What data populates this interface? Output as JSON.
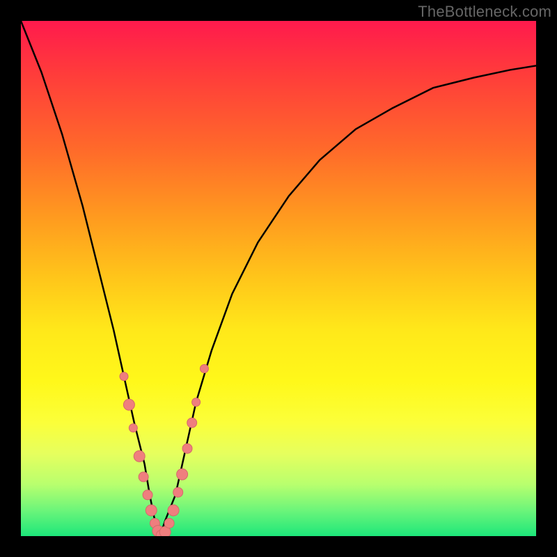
{
  "watermark": "TheBottleneck.com",
  "colors": {
    "curve": "#000000",
    "dot_fill": "#ef7e7e",
    "dot_stroke": "#d46a6a",
    "frame_bg_stops": [
      "#ff1a4d",
      "#ff3b3b",
      "#ff6a2a",
      "#ff9a1f",
      "#ffc61a",
      "#ffe81a",
      "#fff81a",
      "#fbff3a",
      "#e6ff5e",
      "#b8ff6e",
      "#6cf57a",
      "#1de77a"
    ]
  },
  "chart_data": {
    "type": "line",
    "title": "",
    "xlabel": "",
    "ylabel": "",
    "xlim": [
      0,
      100
    ],
    "ylim": [
      0,
      100
    ],
    "grid": false,
    "series": [
      {
        "name": "bottleneck-curve",
        "x": [
          0,
          4,
          8,
          12,
          15,
          18,
          20,
          22,
          24,
          25,
          26,
          27,
          28,
          30,
          32,
          34,
          37,
          41,
          46,
          52,
          58,
          65,
          72,
          80,
          88,
          95,
          100
        ],
        "values": [
          100,
          90,
          78,
          64,
          52,
          40,
          31,
          22,
          14,
          8,
          3,
          0,
          3,
          8,
          17,
          26,
          36,
          47,
          57,
          66,
          73,
          79,
          83,
          87,
          89,
          90.5,
          91.3
        ]
      }
    ],
    "scatter": {
      "name": "sample-points",
      "points": [
        {
          "x": 20.0,
          "y": 31.0,
          "r": 6
        },
        {
          "x": 21.0,
          "y": 25.5,
          "r": 8
        },
        {
          "x": 21.8,
          "y": 21.0,
          "r": 6
        },
        {
          "x": 23.0,
          "y": 15.5,
          "r": 8
        },
        {
          "x": 23.8,
          "y": 11.5,
          "r": 7
        },
        {
          "x": 24.6,
          "y": 8.0,
          "r": 7
        },
        {
          "x": 25.3,
          "y": 5.0,
          "r": 8
        },
        {
          "x": 26.0,
          "y": 2.5,
          "r": 7
        },
        {
          "x": 26.6,
          "y": 1.0,
          "r": 8
        },
        {
          "x": 27.2,
          "y": 0.2,
          "r": 7
        },
        {
          "x": 28.0,
          "y": 0.8,
          "r": 8
        },
        {
          "x": 28.8,
          "y": 2.5,
          "r": 7
        },
        {
          "x": 29.6,
          "y": 5.0,
          "r": 8
        },
        {
          "x": 30.5,
          "y": 8.5,
          "r": 7
        },
        {
          "x": 31.3,
          "y": 12.0,
          "r": 8
        },
        {
          "x": 32.3,
          "y": 17.0,
          "r": 7
        },
        {
          "x": 33.2,
          "y": 22.0,
          "r": 7
        },
        {
          "x": 34.0,
          "y": 26.0,
          "r": 6
        },
        {
          "x": 35.6,
          "y": 32.5,
          "r": 6
        }
      ]
    }
  }
}
